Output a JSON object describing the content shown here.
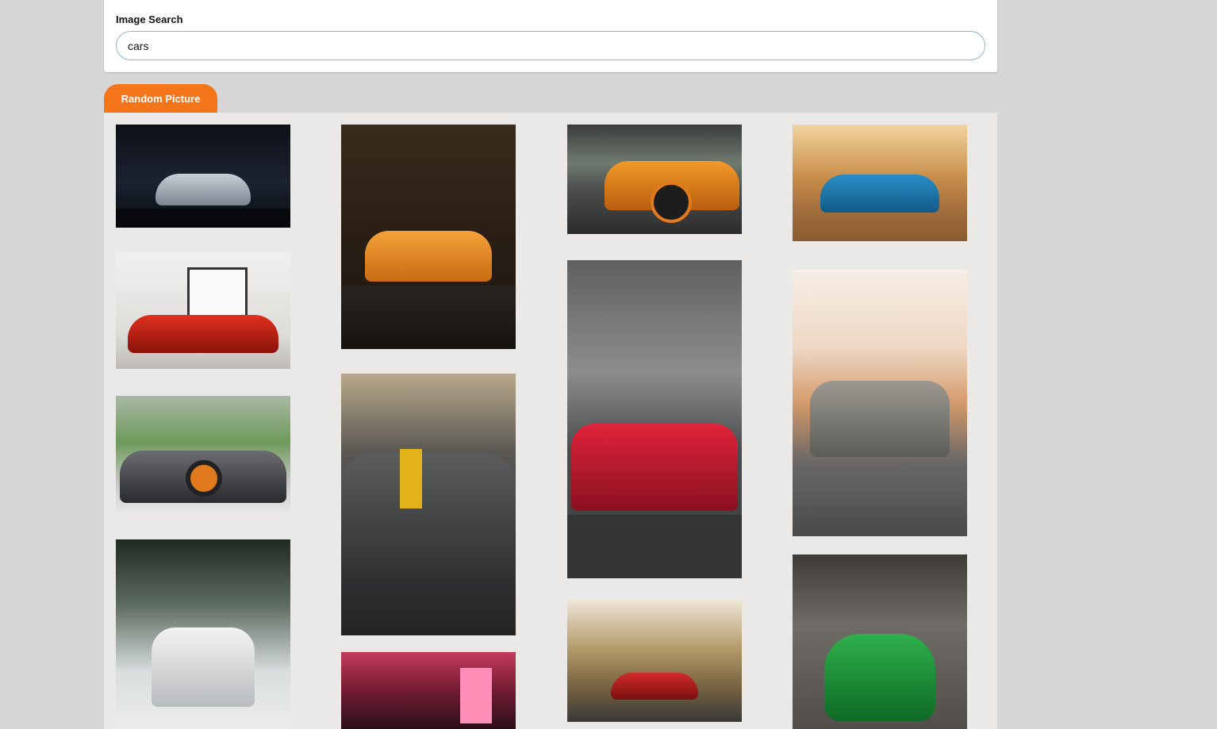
{
  "search": {
    "label": "Image Search",
    "value": "cars"
  },
  "random_button": {
    "label": "Random Picture"
  },
  "accent_color": "#f5761a",
  "photos": [
    {
      "name": "photo-silver-camaro-garage"
    },
    {
      "name": "photo-orange-lamborghini-forest"
    },
    {
      "name": "photo-orange-huracan-road"
    },
    {
      "name": "photo-blue-camaro-desert"
    },
    {
      "name": "photo-red-ferrari-showroom"
    },
    {
      "name": "photo-red-porsche-gt2rs-street"
    },
    {
      "name": "photo-gray-challenger-sunset"
    },
    {
      "name": "photo-gray-lamborghini-aventador"
    },
    {
      "name": "photo-gray-mercedes-amg-yellow-stripe"
    },
    {
      "name": "photo-white-audi-q5-snow-forest"
    },
    {
      "name": "photo-red-mercedes-amg-gt-forest"
    },
    {
      "name": "photo-green-mustang-parking"
    },
    {
      "name": "photo-pink-neon-garage"
    }
  ]
}
